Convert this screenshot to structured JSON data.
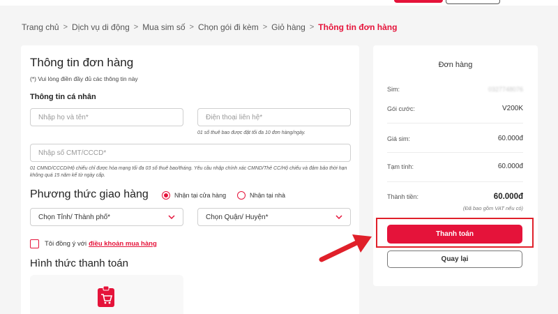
{
  "breadcrumb": [
    "Trang chủ",
    "Dịch vụ di động",
    "Mua sim số",
    "Chọn gói đi kèm",
    "Giỏ hàng",
    "Thông tin đơn hàng"
  ],
  "form": {
    "title": "Thông tin đơn hàng",
    "required_note": "(*) Vui lòng điền đầy đủ các thông tin này",
    "personal_heading": "Thông tin cá nhân",
    "name_placeholder": "Nhập họ và tên*",
    "phone_placeholder": "Điện thoại liên hệ*",
    "phone_note": "01 số thuê bao được đặt tối đa 10 đơn hàng/ngày.",
    "id_placeholder": "Nhập số CMT/CCCD*",
    "id_note": "01 CMND/CCCD/Hộ chiếu chỉ được hòa mạng tối đa 03 số thuê bao/tháng. Yêu cầu nhập chính xác CMND/Thẻ CC/Hộ chiếu và đảm bảo thời hạn không quá 15 năm kể từ ngày cấp."
  },
  "shipping": {
    "heading": "Phương thức giao hàng",
    "option_store": "Nhận tại cửa hàng",
    "option_home": "Nhận tại nhà",
    "selected": "store",
    "province_select": "Chọn Tỉnh/ Thành phố*",
    "district_select": "Chọn Quận/ Huyện*"
  },
  "agreement": {
    "text": "Tôi đồng ý với",
    "link": "điều khoản mua hàng"
  },
  "payment": {
    "heading": "Hình thức thanh toán",
    "icon": "cart-icon"
  },
  "order": {
    "title": "Đơn hàng",
    "sim_label": "Sim:",
    "sim_value": "0327748076",
    "package_label": "Gói cước:",
    "package_value": "V200K",
    "sim_price_label": "Giá sim:",
    "sim_price_value": "60.000đ",
    "subtotal_label": "Tạm tính:",
    "subtotal_value": "60.000đ",
    "total_label": "Thành tiền:",
    "total_value": "60.000đ",
    "vat_note": "(Đã bao gồm VAT nếu có)",
    "pay_button": "Thanh toán",
    "back_button": "Quay lại"
  },
  "colors": {
    "accent": "#e5133a",
    "annotation": "#e0202a"
  }
}
